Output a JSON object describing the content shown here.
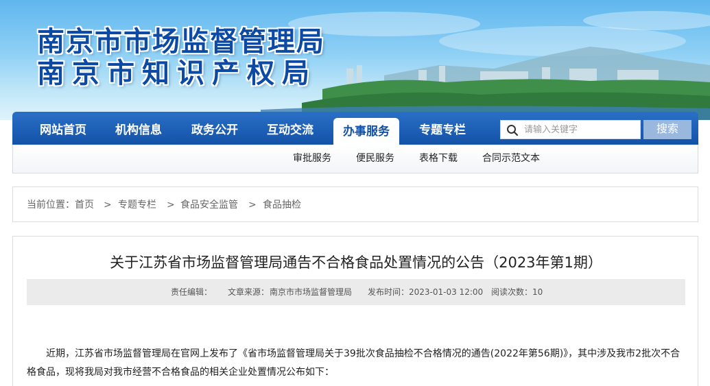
{
  "site": {
    "title_line1": "南京市市场监督管理局",
    "title_line2": "南京市知识产权局"
  },
  "nav": {
    "items": [
      "网站首页",
      "机构信息",
      "政务公开",
      "互动交流",
      "办事服务",
      "专题专栏"
    ],
    "active": "办事服务"
  },
  "search": {
    "placeholder": "请输入关键字",
    "button_label": "搜索"
  },
  "subnav": {
    "items": [
      "审批服务",
      "便民服务",
      "表格下载",
      "合同示范文本"
    ]
  },
  "breadcrumb": {
    "prefix": "当前位置：",
    "items": [
      "首页",
      "专题专栏",
      "食品安全监管",
      "食品抽检"
    ],
    "separator": ">"
  },
  "article": {
    "title": "关于江苏省市场监督管理局通告不合格食品处置情况的公告（2023年第1期）",
    "meta": {
      "editor_label": "责任编辑：",
      "source_label": "文章来源：",
      "source": "南京市市场监督管理局",
      "date_label": "发布时间：",
      "date": "2023-01-03 12:00",
      "views_label": "阅读次数：",
      "views": "10"
    },
    "paragraph": "近期，江苏省市场监督管理局在官网上发布了《省市场监督管理局关于39批次食品抽检不合格情况的通告(2022年第56期)》，其中涉及我市2批次不合格食品，现将我局对我市经营不合格食品的相关企业处置情况公布如下："
  },
  "colors": {
    "nav_bg": "#1a5db3",
    "title_blue": "#0d4aa3",
    "search_button": "#9ab7de"
  }
}
